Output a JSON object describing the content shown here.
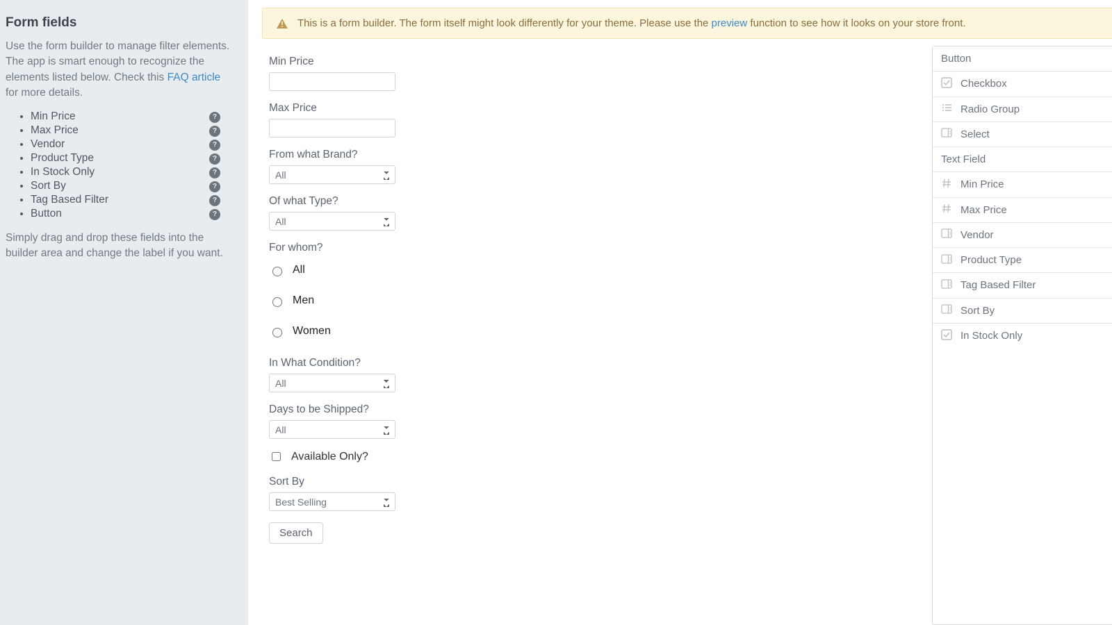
{
  "sidebar": {
    "title": "Form fields",
    "intro_part1": "Use the form builder to manage filter elements. The app is smart enough to recognize the elements listed below. Check this ",
    "intro_link": "FAQ article",
    "intro_part2": " for more details.",
    "items": [
      {
        "label": "Min Price"
      },
      {
        "label": "Max Price"
      },
      {
        "label": "Vendor"
      },
      {
        "label": "Product Type"
      },
      {
        "label": "In Stock Only"
      },
      {
        "label": "Sort By"
      },
      {
        "label": "Tag Based Filter"
      },
      {
        "label": "Button"
      }
    ],
    "help_glyph": "?",
    "footer": "Simply drag and drop these fields into the builder area and change the label if you want."
  },
  "notice": {
    "text_before": "This is a form builder. The form itself might look differently for your theme. Please use the ",
    "link": "preview",
    "text_after": " function to see how it looks on your store front."
  },
  "form": {
    "min_price": {
      "label": "Min Price",
      "value": ""
    },
    "max_price": {
      "label": "Max Price",
      "value": ""
    },
    "brand": {
      "label": "From what Brand?",
      "value": "All"
    },
    "type": {
      "label": "Of what Type?",
      "value": "All"
    },
    "whom": {
      "label": "For whom?",
      "options": [
        "All",
        "Men",
        "Women"
      ],
      "selected": ""
    },
    "condition": {
      "label": "In What Condition?",
      "value": "All"
    },
    "ship_days": {
      "label": "Days to be Shipped?",
      "value": "All"
    },
    "available": {
      "label": "Available Only?",
      "checked": false
    },
    "sort_by": {
      "label": "Sort By",
      "value": "Best Selling"
    },
    "submit": {
      "label": "Search"
    }
  },
  "palette": [
    {
      "label": "Button",
      "icon": ""
    },
    {
      "label": "Checkbox",
      "icon": "check"
    },
    {
      "label": "Radio Group",
      "icon": "list"
    },
    {
      "label": "Select",
      "icon": "select"
    },
    {
      "label": "Text Field",
      "icon": ""
    },
    {
      "label": "Min Price",
      "icon": "hash"
    },
    {
      "label": "Max Price",
      "icon": "hash"
    },
    {
      "label": "Vendor",
      "icon": "select"
    },
    {
      "label": "Product Type",
      "icon": "select"
    },
    {
      "label": "Tag Based Filter",
      "icon": "select"
    },
    {
      "label": "Sort By",
      "icon": "select"
    },
    {
      "label": "In Stock Only",
      "icon": "check"
    }
  ]
}
